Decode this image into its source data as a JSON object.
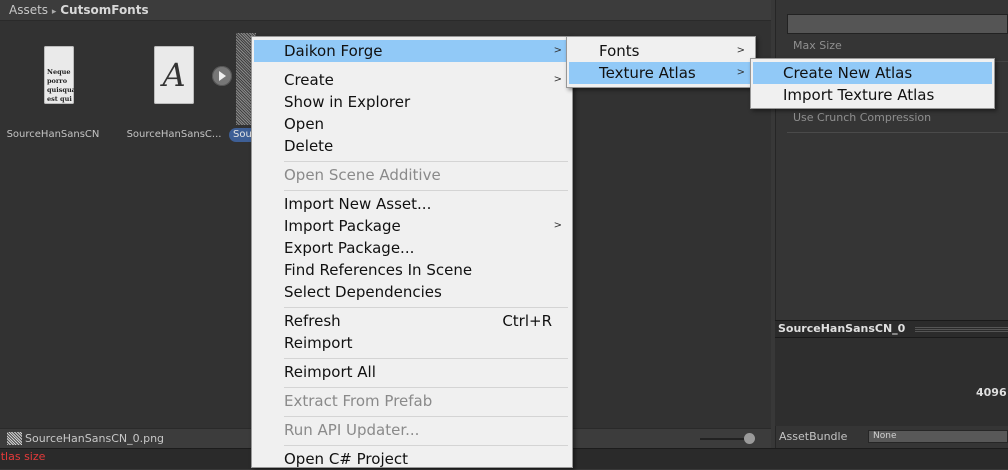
{
  "breadcrumb": {
    "root": "Assets",
    "separator": "▸",
    "current": "CutsomFonts"
  },
  "assets": [
    {
      "label": "SourceHanSansCN",
      "preview_text": "Neque porro quisquam est qui dolorem."
    },
    {
      "label": "SourceHanSansC...",
      "glyph": "A"
    },
    {
      "label": "Sou"
    }
  ],
  "footer": {
    "selected_file": "SourceHanSansCN_0.png"
  },
  "status": {
    "message": "atlas size"
  },
  "inspector": {
    "max_size_label": "Max Size",
    "crunch_label": "Use Crunch Compression",
    "preview_title": "SourceHanSansCN_0",
    "preview_size": "4096",
    "assetbundle_label": "AssetBundle",
    "assetbundle_value": "None"
  },
  "context_menu": {
    "items": [
      {
        "label": "Daikon Forge",
        "submenu": true,
        "highlighted": true
      },
      {
        "label": "Create",
        "submenu": true
      },
      {
        "label": "Show in Explorer"
      },
      {
        "label": "Open"
      },
      {
        "label": "Delete"
      },
      {
        "label": "Open Scene Additive",
        "disabled": true
      },
      {
        "label": "Import New Asset..."
      },
      {
        "label": "Import Package",
        "submenu": true
      },
      {
        "label": "Export Package..."
      },
      {
        "label": "Find References In Scene"
      },
      {
        "label": "Select Dependencies"
      },
      {
        "label": "Refresh",
        "shortcut": "Ctrl+R"
      },
      {
        "label": "Reimport"
      },
      {
        "label": "Reimport All"
      },
      {
        "label": "Extract From Prefab",
        "disabled": true
      },
      {
        "label": "Run API Updater...",
        "disabled": true
      },
      {
        "label": "Open C# Project"
      }
    ]
  },
  "daikon_submenu": {
    "items": [
      {
        "label": "Fonts",
        "submenu": true
      },
      {
        "label": "Texture Atlas",
        "submenu": true,
        "highlighted": true
      }
    ]
  },
  "atlas_submenu": {
    "items": [
      {
        "label": "Create New Atlas",
        "highlighted": true
      },
      {
        "label": "Import Texture Atlas"
      }
    ]
  }
}
